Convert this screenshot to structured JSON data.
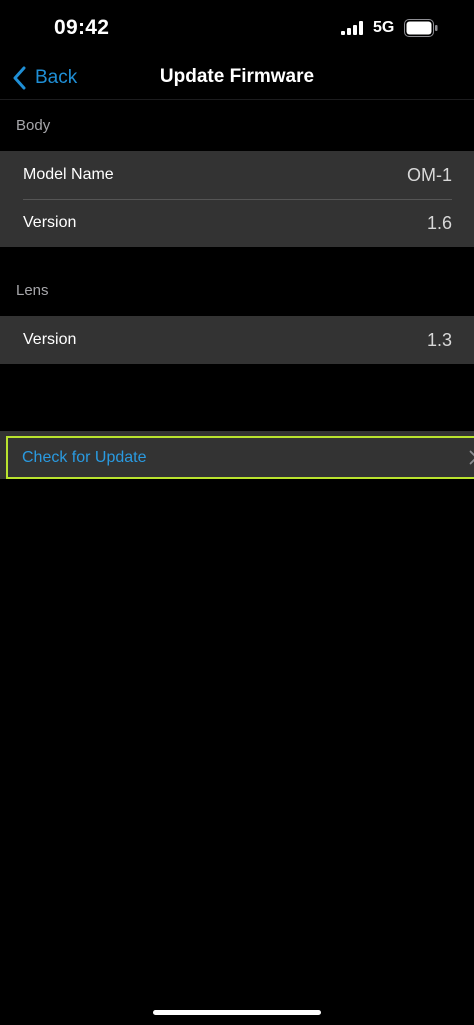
{
  "status_bar": {
    "time": "09:42",
    "network": "5G",
    "icons": [
      "signal-icon",
      "battery-icon"
    ]
  },
  "nav": {
    "back_label": "Back",
    "title": "Update Firmware",
    "icons": [
      "chevron-left-icon"
    ]
  },
  "body_section": {
    "header": "Body",
    "rows": [
      {
        "label": "Model Name",
        "value": "OM-1"
      },
      {
        "label": "Version",
        "value": "1.6"
      }
    ]
  },
  "lens_section": {
    "header": "Lens",
    "rows": [
      {
        "label": "Version",
        "value": "1.3"
      }
    ]
  },
  "update": {
    "label": "Check for Update",
    "icon": "chevron-right-icon"
  },
  "colors": {
    "accent": "#1f8fd6",
    "highlight_border": "#b9e32e",
    "row_background": "#333333",
    "background": "#000000"
  }
}
